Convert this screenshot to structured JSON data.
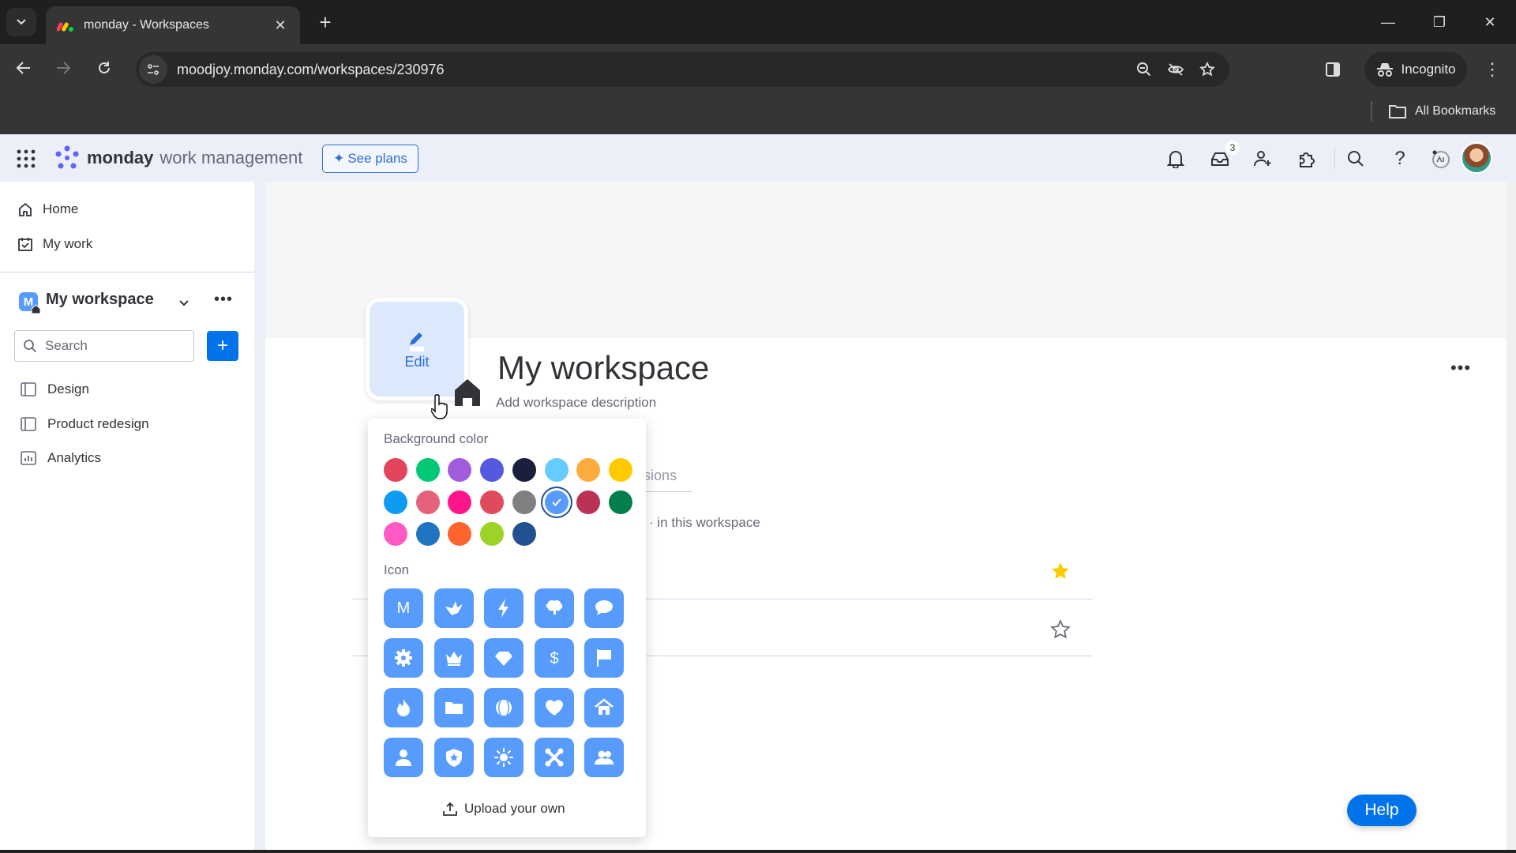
{
  "browser": {
    "tab_title": "monday - Workspaces",
    "url": "moodjoy.monday.com/workspaces/230976",
    "incognito_label": "Incognito",
    "bookmarks_label": "All Bookmarks"
  },
  "header": {
    "brand_bold": "monday",
    "brand_light": "work management",
    "see_plans": "See plans",
    "inbox_badge": "3",
    "icons": [
      "bell-icon",
      "inbox-icon",
      "invite-members-icon",
      "apps-icon",
      "search-icon",
      "help-icon",
      "ai-assistant-icon",
      "user-avatar"
    ]
  },
  "sidebar": {
    "nav": [
      {
        "label": "Home",
        "icon": "home-icon"
      },
      {
        "label": "My work",
        "icon": "calendar-check-icon"
      }
    ],
    "workspace": {
      "badge": "M",
      "name": "My workspace"
    },
    "search_placeholder": "Search",
    "add_label": "+",
    "boards": [
      {
        "label": "Design",
        "icon": "board-icon"
      },
      {
        "label": "Product redesign",
        "icon": "board-icon"
      },
      {
        "label": "Analytics",
        "icon": "dashboard-icon"
      }
    ]
  },
  "main": {
    "avatar_edit_label": "Edit",
    "title": "My workspace",
    "description_placeholder": "Add workspace description",
    "tab_partial": "ssions",
    "members_text_partial": "· in this workspace",
    "more_label": "•••"
  },
  "popover": {
    "background_label": "Background color",
    "colors": [
      "#e2445c",
      "#00c875",
      "#a25ddc",
      "#5559df",
      "#1c1f3b",
      "#66ccff",
      "#fdab3d",
      "#ffcb00",
      "#0f9bf2",
      "#e4627b",
      "#ff158a",
      "#df4a5d",
      "#808080",
      "#579bfc",
      "#bb3354",
      "#037f4c",
      "#ff5ac4",
      "#2075c2",
      "#ff642e",
      "#9cd326",
      "#225091"
    ],
    "selected_color": "#579bfc",
    "icon_label": "Icon",
    "icons": [
      "letter-m-icon",
      "origami-bird-icon",
      "lightning-icon",
      "brain-icon",
      "chat-bubble-icon",
      "gear-icon",
      "crown-icon",
      "diamond-icon",
      "dollar-icon",
      "flag-icon",
      "fire-icon",
      "folder-icon",
      "ball-icon",
      "heart-icon",
      "house-icon",
      "person-icon",
      "shield-star-icon",
      "sun-icon",
      "tools-icon",
      "people-icon"
    ],
    "upload_label": "Upload your own"
  },
  "help_label": "Help",
  "colors": {
    "primary": "#0073ea",
    "icon_tile": "#579bfc",
    "star": "#ffcb00"
  }
}
